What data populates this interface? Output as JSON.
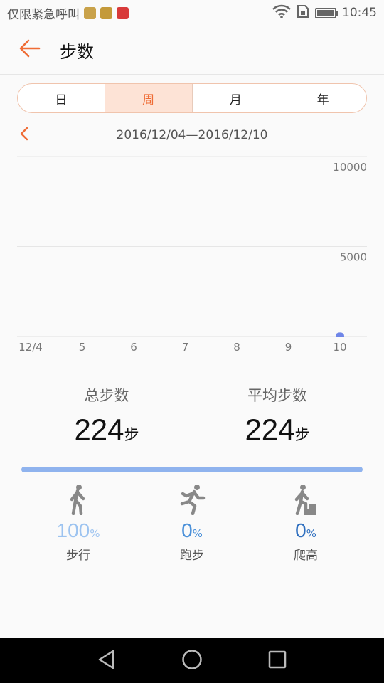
{
  "status_bar": {
    "text": "仅限紧急呼叫",
    "time": "10:45",
    "icons": [
      "gallery-notification-icon",
      "shield-notification-icon",
      "huawei-notification-icon",
      "wifi-icon",
      "sim-icon",
      "battery-icon"
    ]
  },
  "header": {
    "title": "步数",
    "back_icon": "arrow-left-icon"
  },
  "tabs": [
    {
      "label": "日",
      "active": false
    },
    {
      "label": "周",
      "active": true
    },
    {
      "label": "月",
      "active": false
    },
    {
      "label": "年",
      "active": false
    }
  ],
  "date_range": "2016/12/04—2016/12/10",
  "chart_data": {
    "type": "bar",
    "categories": [
      "12/4",
      "5",
      "6",
      "7",
      "8",
      "9",
      "10"
    ],
    "values": [
      0,
      0,
      0,
      0,
      0,
      0,
      224
    ],
    "y_ticks": [
      "10000",
      "5000"
    ],
    "ylim": [
      0,
      10000
    ],
    "title": "",
    "xlabel": "",
    "ylabel": "",
    "grid": true,
    "bar_color": "#6f86e8"
  },
  "summary": {
    "total_label": "总步数",
    "total_value": "224",
    "average_label": "平均步数",
    "average_value": "224",
    "unit": "步"
  },
  "progress": {
    "walk_fraction": 1.0,
    "color": "#8fb3ee"
  },
  "activities": [
    {
      "label": "步行",
      "percent": "100",
      "sign": "%",
      "icon": "walking-icon",
      "color": "#9cc3f0"
    },
    {
      "label": "跑步",
      "percent": "0",
      "sign": "%",
      "icon": "running-icon",
      "color": "#4a90d9"
    },
    {
      "label": "爬高",
      "percent": "0",
      "sign": "%",
      "icon": "climbing-icon",
      "color": "#2f6fbf"
    }
  ],
  "colors": {
    "accent": "#ef6c35",
    "active_tab_bg": "#fde3d6"
  }
}
